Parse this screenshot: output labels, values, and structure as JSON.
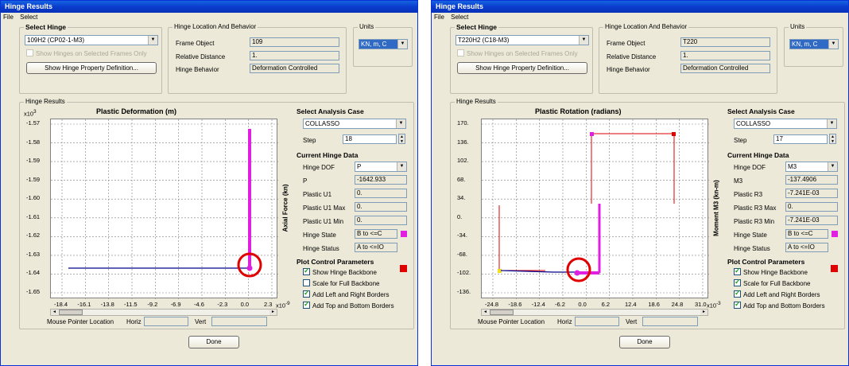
{
  "windows": [
    {
      "title": "Hinge Results",
      "menu": [
        "File",
        "Select"
      ],
      "select_hinge": {
        "group_title": "Select Hinge",
        "hinge": "109H2 (CP02-1-M3)",
        "show_selected_label": "Show Hinges on Selected Frames Only",
        "definition_button": "Show Hinge Property Definition..."
      },
      "location": {
        "group_title": "Hinge Location And Behavior",
        "frame_object_label": "Frame Object",
        "frame_object": "109",
        "relative_distance_label": "Relative Distance",
        "relative_distance": "1.",
        "hinge_behavior_label": "Hinge Behavior",
        "hinge_behavior": "Deformation Controlled"
      },
      "units": {
        "group_title": "Units",
        "value": "KN, m, C"
      },
      "results_group_title": "Hinge Results",
      "plot": {
        "title": "Plastic Deformation  (m)",
        "y_exp": "x10",
        "y_exp_sup": "3",
        "y_axis_label": "Axial Force  (kn)",
        "y_ticks": [
          "-1.57",
          "-1.58",
          "-1.59",
          "-1.59",
          "-1.60",
          "-1.61",
          "-1.62",
          "-1.63",
          "-1.64",
          "-1.65"
        ],
        "x_ticks": [
          "-18.4",
          "-16.1",
          "-13.8",
          "-11.5",
          "-9.2",
          "-6.9",
          "-4.6",
          "-2.3",
          "0.0",
          "2.3"
        ],
        "x_exp": "x10",
        "x_exp_sup": "-9"
      },
      "analysis": {
        "header": "Select Analysis Case",
        "case": "COLLASSO",
        "step_label": "Step",
        "step": "18"
      },
      "current": {
        "header": "Current Hinge Data",
        "dof_label": "Hinge DOF",
        "dof": "P",
        "rows": [
          {
            "label": "P",
            "value": "-1642.933"
          },
          {
            "label": "Plastic U1",
            "value": "0."
          },
          {
            "label": "Plastic U1 Max",
            "value": "0."
          },
          {
            "label": "Plastic U1 Min",
            "value": "0."
          }
        ],
        "state_label": "Hinge State",
        "state": "B to <=C",
        "state_color": "#e020e0",
        "status_label": "Hinge Status",
        "status": "A to <=IO"
      },
      "plot_control": {
        "header": "Plot Control Parameters",
        "backbone_color": "#e00000",
        "options": [
          {
            "label": "Show Hinge Backbone",
            "checked": true
          },
          {
            "label": "Scale for Full Backbone",
            "checked": false
          },
          {
            "label": "Add Left and Right Borders",
            "checked": true
          },
          {
            "label": "Add Top and Bottom Borders",
            "checked": true
          }
        ]
      },
      "mouse": {
        "label": "Mouse Pointer Location",
        "horiz_label": "Horiz",
        "vert_label": "Vert"
      },
      "done": "Done"
    },
    {
      "title": "Hinge Results",
      "menu": [
        "File",
        "Select"
      ],
      "select_hinge": {
        "group_title": "Select Hinge",
        "hinge": "T220H2 (C18-M3)",
        "show_selected_label": "Show Hinges on Selected Frames Only",
        "definition_button": "Show Hinge Property Definition..."
      },
      "location": {
        "group_title": "Hinge Location And Behavior",
        "frame_object_label": "Frame Object",
        "frame_object": "T220",
        "relative_distance_label": "Relative Distance",
        "relative_distance": "1.",
        "hinge_behavior_label": "Hinge Behavior",
        "hinge_behavior": "Deformation Controlled"
      },
      "units": {
        "group_title": "Units",
        "value": "KN, m, C"
      },
      "results_group_title": "Hinge Results",
      "plot": {
        "title": "Plastic Rotation  (radians)",
        "y_exp": "",
        "y_exp_sup": "",
        "y_axis_label": "Moment M3  (kn-m)",
        "y_ticks": [
          "170.",
          "136.",
          "102.",
          "68.",
          "34.",
          "0.",
          "-34.",
          "-68.",
          "-102.",
          "-136."
        ],
        "x_ticks": [
          "-24.8",
          "-18.6",
          "-12.4",
          "-6.2",
          "0.0",
          "6.2",
          "12.4",
          "18.6",
          "24.8",
          "31.0"
        ],
        "x_exp": "x10",
        "x_exp_sup": "-3"
      },
      "analysis": {
        "header": "Select Analysis Case",
        "case": "COLLASSO",
        "step_label": "Step",
        "step": "17"
      },
      "current": {
        "header": "Current Hinge Data",
        "dof_label": "Hinge DOF",
        "dof": "M3",
        "rows": [
          {
            "label": "M3",
            "value": "-137.4906"
          },
          {
            "label": "Plastic R3",
            "value": "-7.241E-03"
          },
          {
            "label": "Plastic R3 Max",
            "value": "0."
          },
          {
            "label": "Plastic R3 Min",
            "value": "-7.241E-03"
          }
        ],
        "state_label": "Hinge State",
        "state": "B to <=C",
        "state_color": "#e020e0",
        "status_label": "Hinge Status",
        "status": "A to <=IO"
      },
      "plot_control": {
        "header": "Plot Control Parameters",
        "backbone_color": "#e00000",
        "options": [
          {
            "label": "Show Hinge Backbone",
            "checked": true
          },
          {
            "label": "Scale for Full Backbone",
            "checked": true
          },
          {
            "label": "Add Left and Right Borders",
            "checked": true
          },
          {
            "label": "Add Top and Bottom Borders",
            "checked": true
          }
        ]
      },
      "mouse": {
        "label": "Mouse Pointer Location",
        "horiz_label": "Horiz",
        "vert_label": "Vert"
      },
      "done": "Done"
    }
  ]
}
